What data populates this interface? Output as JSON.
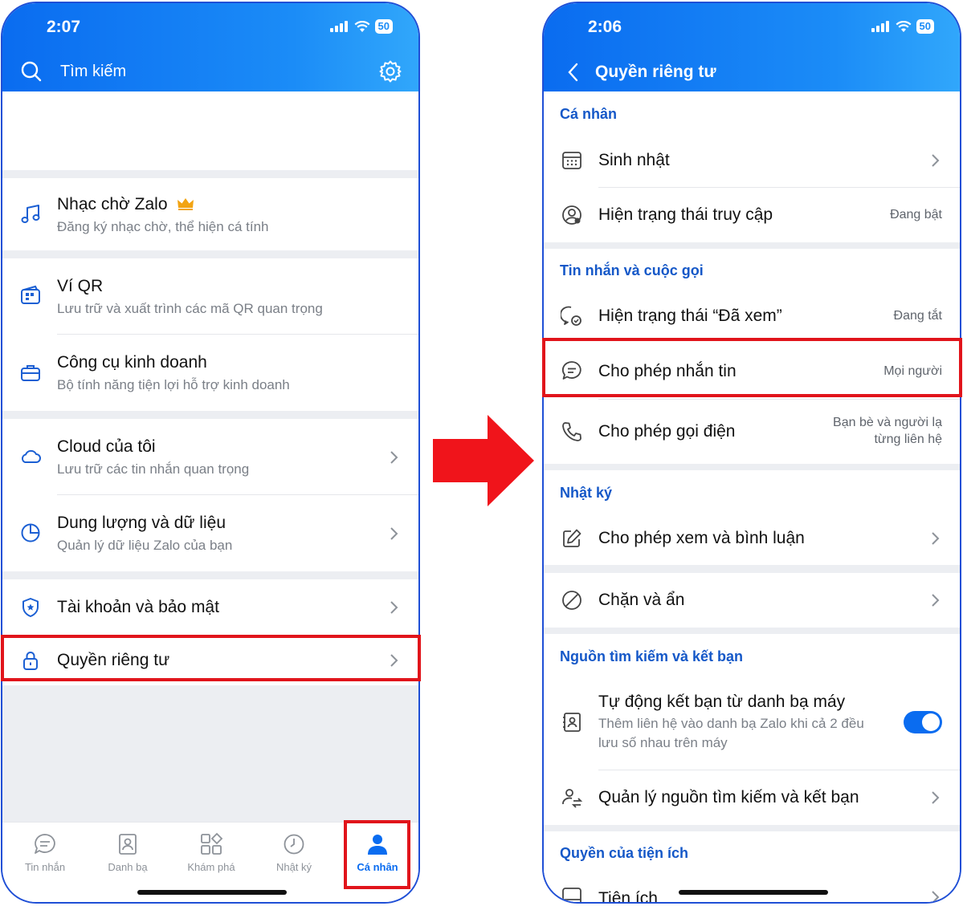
{
  "left_screen": {
    "status_time": "2:07",
    "battery": "50",
    "search_label": "Tìm kiếm",
    "items": [
      {
        "title": "Nhạc chờ Zalo",
        "subtitle": "Đăng ký nhạc chờ, thể hiện cá tính",
        "icon": "music-note-icon",
        "badge": "crown-icon"
      },
      {
        "title": "Ví QR",
        "subtitle": "Lưu trữ và xuất trình các mã QR quan trọng",
        "icon": "qr-wallet-icon"
      },
      {
        "title": "Công cụ kinh doanh",
        "subtitle": "Bộ tính năng tiện lợi hỗ trợ kinh doanh",
        "icon": "briefcase-icon"
      },
      {
        "title": "Cloud của tôi",
        "subtitle": "Lưu trữ các tin nhắn quan trọng",
        "icon": "cloud-icon"
      },
      {
        "title": "Dung lượng và dữ liệu",
        "subtitle": "Quản lý dữ liệu Zalo của bạn",
        "icon": "pie-chart-icon"
      },
      {
        "title": "Tài khoản và bảo mật",
        "icon": "shield-icon"
      },
      {
        "title": "Quyền riêng tư",
        "icon": "lock-icon"
      }
    ],
    "nav": [
      {
        "label": "Tin nhắn",
        "icon": "chat-icon"
      },
      {
        "label": "Danh bạ",
        "icon": "contacts-icon"
      },
      {
        "label": "Khám phá",
        "icon": "grid-icon"
      },
      {
        "label": "Nhật ký",
        "icon": "clock-icon"
      },
      {
        "label": "Cá nhân",
        "icon": "person-icon",
        "active": true
      }
    ]
  },
  "right_screen": {
    "status_time": "2:06",
    "battery": "50",
    "title": "Quyền riêng tư",
    "sections": {
      "personal": "Cá nhân",
      "messages_calls": "Tin nhắn và cuộc gọi",
      "diary": "Nhật ký",
      "search_friends": "Nguồn tìm kiếm và kết bạn",
      "utilities": "Quyền của tiện ích"
    },
    "rows": {
      "birthday": {
        "label": "Sinh nhật"
      },
      "online_status": {
        "label": "Hiện trạng thái truy cập",
        "value": "Đang bật"
      },
      "seen_status": {
        "label": "Hiện trạng thái “Đã xem”",
        "value": "Đang tắt"
      },
      "allow_message": {
        "label": "Cho phép nhắn tin",
        "value": "Mọi người"
      },
      "allow_call": {
        "label": "Cho phép gọi điện",
        "value_line1": "Bạn bè và người lạ",
        "value_line2": "từng liên hệ"
      },
      "diary_view": {
        "label": "Cho phép xem và bình luận"
      },
      "block_hide": {
        "label": "Chặn và ẩn"
      },
      "auto_friend": {
        "label": "Tự động kết bạn từ danh bạ máy",
        "sub_line1": "Thêm liên hệ vào danh bạ Zalo khi cả 2 đều",
        "sub_line2": "lưu số nhau trên máy",
        "toggle_on": true
      },
      "manage_sources": {
        "label": "Quản lý nguồn tìm kiếm và kết bạn"
      },
      "utilities": {
        "label": "Tiện ích"
      }
    }
  },
  "colors": {
    "header_blue": "#0a6cf0",
    "section_blue": "#1558c8",
    "highlight_red": "#e1141b",
    "arrow_red": "#f0141b"
  }
}
